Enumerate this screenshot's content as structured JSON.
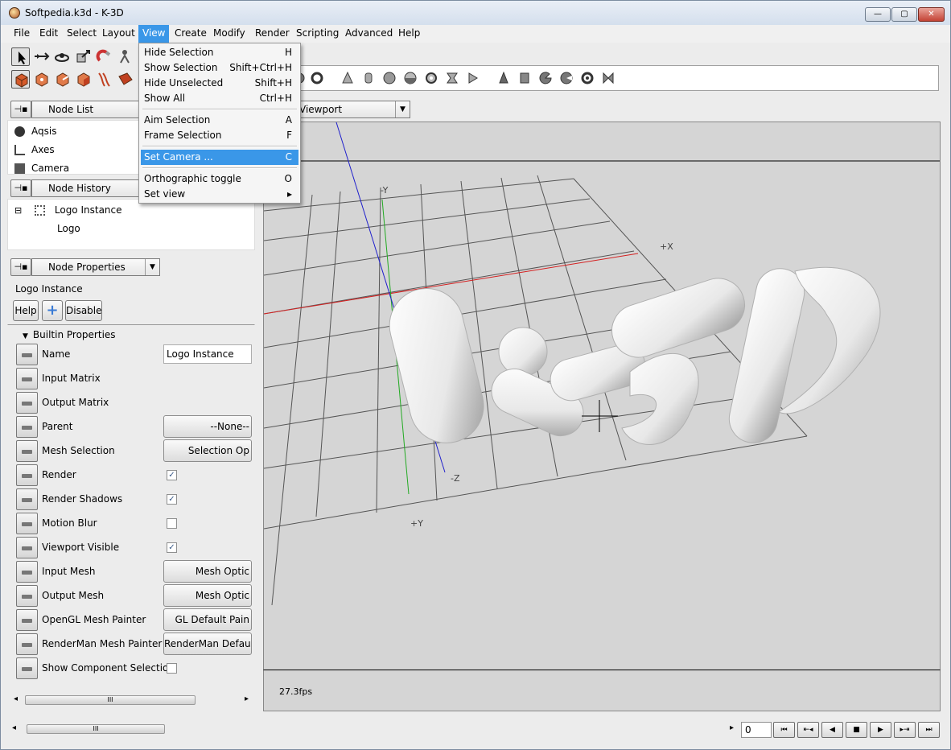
{
  "window": {
    "title": "Softpedia.k3d - K-3D",
    "min_label": "—",
    "max_label": "▢",
    "close_label": "✕"
  },
  "menubar": {
    "items": [
      "File",
      "Edit",
      "Select",
      "Layout",
      "View",
      "Create",
      "Modify",
      "Render",
      "Scripting",
      "Advanced",
      "Help"
    ],
    "active": "View"
  },
  "view_menu": {
    "items": [
      {
        "label": "Hide Selection",
        "accel": "H"
      },
      {
        "label": "Show Selection",
        "accel": "Shift+Ctrl+H"
      },
      {
        "label": "Hide Unselected",
        "accel": "Shift+H"
      },
      {
        "label": "Show All",
        "accel": "Ctrl+H"
      },
      {
        "label": "Aim Selection",
        "accel": "A"
      },
      {
        "label": "Frame Selection",
        "accel": "F"
      },
      {
        "label": "Set Camera ...",
        "accel": "C"
      },
      {
        "label": "Orthographic toggle",
        "accel": "O"
      },
      {
        "label": "Set view",
        "accel": "▸"
      }
    ],
    "highlighted": "Set Camera ..."
  },
  "node_list": {
    "combo": "Node List",
    "items": [
      "Aqsis",
      "Axes",
      "Camera"
    ]
  },
  "node_history": {
    "combo": "Node History",
    "items": [
      {
        "label": "Logo Instance",
        "expander": "⊟"
      },
      {
        "label": "Logo"
      }
    ]
  },
  "node_properties": {
    "combo": "Node Properties",
    "node_name": "Logo Instance",
    "help_label": "Help",
    "add_label": "+",
    "disable_label": "Disable",
    "section_label": "Builtin Properties",
    "properties": [
      {
        "label": "Name",
        "kind": "text",
        "value": "Logo Instance"
      },
      {
        "label": "Input Matrix",
        "kind": "none"
      },
      {
        "label": "Output Matrix",
        "kind": "none"
      },
      {
        "label": "Parent",
        "kind": "button",
        "value": "--None--"
      },
      {
        "label": "Mesh Selection",
        "kind": "button",
        "value": "Selection Op"
      },
      {
        "label": "Render",
        "kind": "check",
        "checked": true
      },
      {
        "label": "Render Shadows",
        "kind": "check",
        "checked": true
      },
      {
        "label": "Motion Blur",
        "kind": "check",
        "checked": false
      },
      {
        "label": "Viewport Visible",
        "kind": "check",
        "checked": true
      },
      {
        "label": "Input Mesh",
        "kind": "button",
        "value": "Mesh Optic"
      },
      {
        "label": "Output Mesh",
        "kind": "button",
        "value": "Mesh Optic"
      },
      {
        "label": "OpenGL Mesh Painter",
        "kind": "button",
        "value": "GL Default Pain"
      },
      {
        "label": "RenderMan Mesh Painter",
        "kind": "button",
        "value": "RenderMan Default"
      },
      {
        "label": "Show Component Selection",
        "kind": "check",
        "checked": false
      }
    ]
  },
  "viewport": {
    "combo": "Viewport",
    "axis_labels": {
      "neg_y": "-Y",
      "pos_x": "+X",
      "neg_z": "-Z",
      "pos_y": "+Y"
    },
    "fps": "27.3fps",
    "colors": {
      "background": "#d5d5d5",
      "grid": "#555555",
      "x_axis": "#d42020",
      "y_axis": "#22aa22",
      "z_axis": "#2020cc",
      "logo": "#f2f2f2"
    }
  },
  "timeline": {
    "frame": "0",
    "controls": [
      "⏮",
      "⇤◂",
      "◀",
      "■",
      "▶",
      "▸⇥",
      "⏭"
    ]
  },
  "scroll_thumb": "III"
}
